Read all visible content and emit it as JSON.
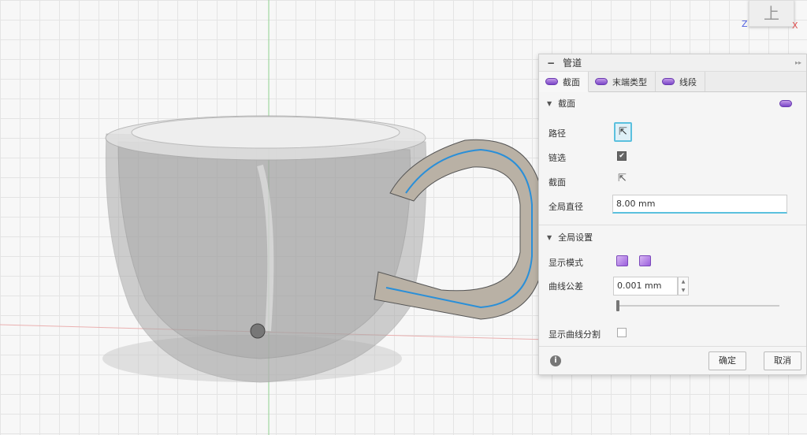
{
  "viewcube": {
    "face": "上",
    "z": "Z",
    "x": "X"
  },
  "panel": {
    "title": "管道",
    "tabs": [
      {
        "label": "截面"
      },
      {
        "label": "末端类型"
      },
      {
        "label": "线段"
      }
    ],
    "section1": {
      "title": "截面",
      "path_label": "路径",
      "chain_label": "链选",
      "chain_checked": true,
      "profile_label": "截面",
      "diameter_label": "全局直径",
      "diameter_value": "8.00 mm"
    },
    "section2": {
      "title": "全局设置",
      "display_mode_label": "显示模式",
      "tolerance_label": "曲线公差",
      "tolerance_value": "0.001 mm",
      "tolerance_slider": 0,
      "show_split_label": "显示曲线分割",
      "show_split_checked": false
    },
    "ok": "确定",
    "cancel": "取消"
  },
  "colors": {
    "accent": "#5bc0de",
    "pipe": "#8a55d0",
    "path": "#2a8fd8"
  }
}
